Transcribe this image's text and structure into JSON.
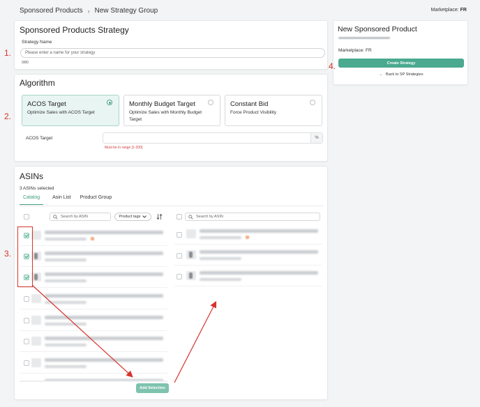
{
  "breadcrumb": {
    "root": "Sponsored Products",
    "separator": "›",
    "current": "New Strategy Group"
  },
  "marketplace_top": {
    "label": "Marketplace:",
    "value": "FR"
  },
  "strategy": {
    "title": "Sponsored Products Strategy",
    "name_label": "Strategy Name",
    "name_placeholder": "Please enter a name for your strategy",
    "name_counter": "0/80"
  },
  "side": {
    "title": "New Sponsored Product",
    "marketplace": "Marketplace: FR",
    "create_button": "Create Strategy",
    "back_arrow": "←",
    "back_link": "Back to SP Strategies"
  },
  "algorithm": {
    "title": "Algorithm",
    "options": [
      {
        "title": "ACOS Target",
        "desc": "Optimize Sales with ACOS Target",
        "selected": true
      },
      {
        "title": "Monthly Budget Target",
        "desc": "Optimize Sales with Monthly Budget Target",
        "selected": false
      },
      {
        "title": "Constant Bid",
        "desc": "Force Product Visibility",
        "selected": false
      }
    ],
    "acos_label": "ACOS Target",
    "acos_suffix": "%",
    "acos_error": "Must be in range [1-200]"
  },
  "asins": {
    "title": "ASINs",
    "selected_count": "3 ASINs selected",
    "tabs": [
      "Catalog",
      "Asin List",
      "Product Group"
    ],
    "search_placeholder_left": "Search by ASIN",
    "search_placeholder_right": "Search by ASIN",
    "product_tags_label": "Product tags",
    "add_selection": "Add Selection",
    "left_rows_checked": [
      true,
      true,
      true,
      false,
      false,
      false,
      false,
      false
    ],
    "right_rows_count": 3
  },
  "annotations": {
    "n1": "1.",
    "n2": "2.",
    "n3": "3.",
    "n4": "4."
  },
  "colors": {
    "accent": "#4aa98f",
    "annotation": "#d6332d",
    "error": "#d23c3c"
  },
  "icons": {
    "search": "search-icon",
    "chevron": "chevron-down-icon",
    "sort": "sort-icon",
    "back": "arrow-left-icon"
  }
}
